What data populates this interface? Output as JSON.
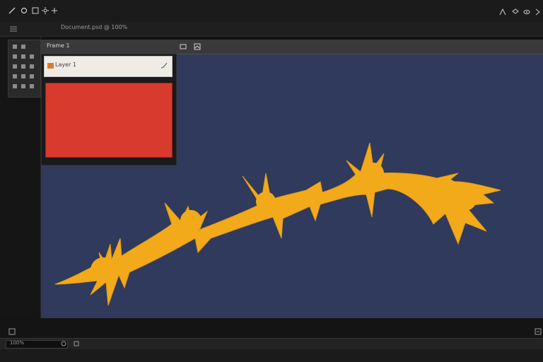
{
  "toolbar": {
    "title_text": "Document.psd @ 100%",
    "icons": [
      "pen-icon",
      "path-icon",
      "mask-icon",
      "settings-icon",
      "move-icon",
      "transform-icon",
      "layers-icon",
      "visibility-icon"
    ]
  },
  "canvas": {
    "label": "Frame 1"
  },
  "layer_panel": {
    "layer_name": "Layer 1"
  },
  "colors": {
    "canvas_bg": "#2f3a5c",
    "shape_fill": "#f2aa1b",
    "swatch_red": "#d93a2e"
  },
  "status": {
    "zoom": "100%"
  }
}
